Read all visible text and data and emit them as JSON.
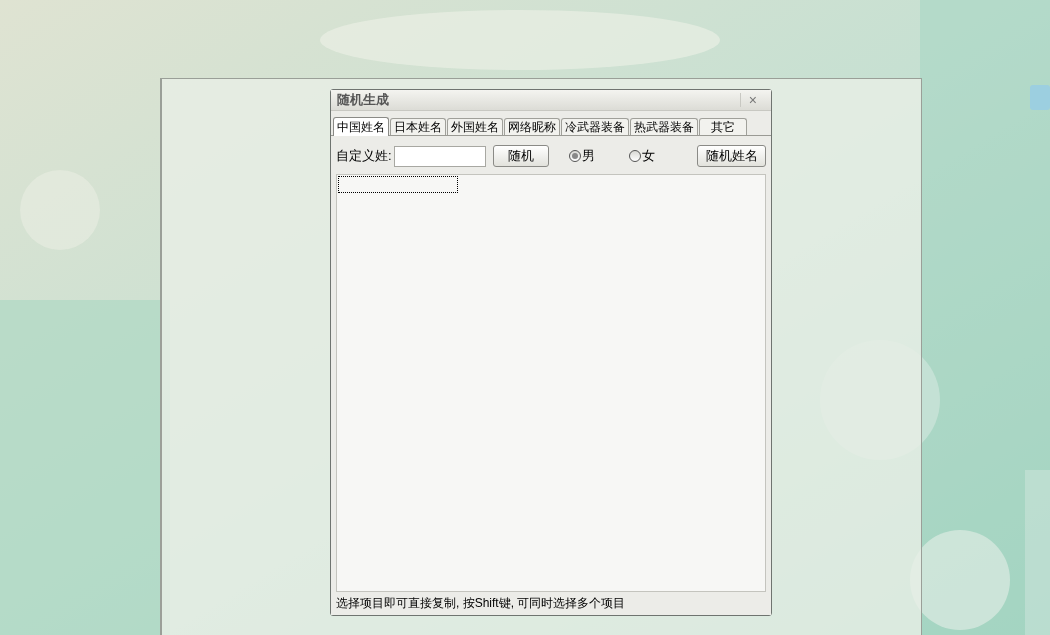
{
  "window": {
    "title": "随机生成",
    "close": "×"
  },
  "tabs": [
    {
      "label": "中国姓名",
      "selected": true
    },
    {
      "label": "日本姓名",
      "selected": false
    },
    {
      "label": "外国姓名",
      "selected": false
    },
    {
      "label": "网络昵称",
      "selected": false
    },
    {
      "label": "冷武器装备",
      "selected": false
    },
    {
      "label": "热武器装备",
      "selected": false
    },
    {
      "label": "其它",
      "selected": false
    }
  ],
  "form": {
    "surname_label": "自定义姓:",
    "random_button": "随机",
    "genders": [
      {
        "label": "男",
        "selected": true
      },
      {
        "label": "女",
        "selected": false
      }
    ],
    "generate_button": "随机姓名"
  },
  "status_bar": "选择项目即可直接复制, 按Shift键, 可同时选择多个项目"
}
